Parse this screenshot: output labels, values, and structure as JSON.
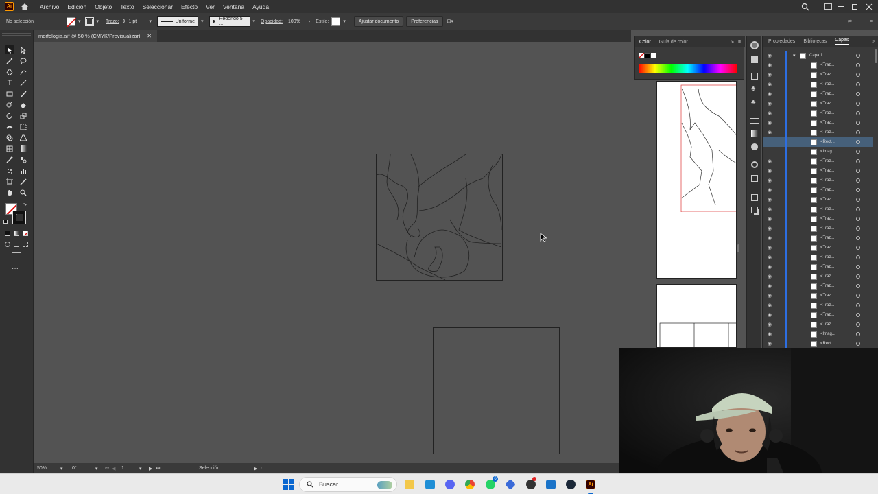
{
  "menubar": {
    "app_logo": "Ai",
    "items": [
      "Archivo",
      "Edición",
      "Objeto",
      "Texto",
      "Seleccionar",
      "Efecto",
      "Ver",
      "Ventana",
      "Ayuda"
    ]
  },
  "controlbar": {
    "selection_state": "No selección",
    "stroke_label": "Trazo:",
    "stroke_weight": "1 pt",
    "profile": "Uniforme",
    "brush": "Redondo 5 ...",
    "opacity_label": "Opacidad:",
    "opacity_value": "100%",
    "style_label": "Estilo:",
    "fit_button": "Ajustar documento",
    "prefs_button": "Preferencias"
  },
  "document_tab": {
    "title": "morfologia.ai* @ 50 % (CMYK/Previsualizar)"
  },
  "statusbar": {
    "zoom": "50%",
    "rotation": "0°",
    "artboard_num": "1",
    "tool_name": "Selección"
  },
  "color_panel": {
    "tabs": [
      "Color",
      "Guía de color"
    ]
  },
  "layers_panel": {
    "tabs": [
      "Propiedades",
      "Bibliotecas",
      "Capas"
    ],
    "active_tab": "Capas",
    "layer_name": "Capa 1",
    "items": [
      "<Traz...",
      "<Traz...",
      "<Traz...",
      "<Traz...",
      "<Traz...",
      "<Traz...",
      "<Traz...",
      "<Traz...",
      "<Rect...",
      "<Imag...",
      "<Traz...",
      "<Traz...",
      "<Traz...",
      "<Traz...",
      "<Traz...",
      "<Traz...",
      "<Traz...",
      "<Traz...",
      "<Traz...",
      "<Traz...",
      "<Traz...",
      "<Traz...",
      "<Traz...",
      "<Traz...",
      "<Traz...",
      "<Traz...",
      "<Traz...",
      "<Traz...",
      "<Imag...",
      "<Rect..."
    ],
    "selected_index": 8
  },
  "taskbar": {
    "search_placeholder": "Buscar",
    "whatsapp_badge": "6"
  },
  "colors": {
    "accent_blue": "#2d6ee0",
    "selected_row": "#46607a",
    "app_orange": "#ff9a00"
  }
}
